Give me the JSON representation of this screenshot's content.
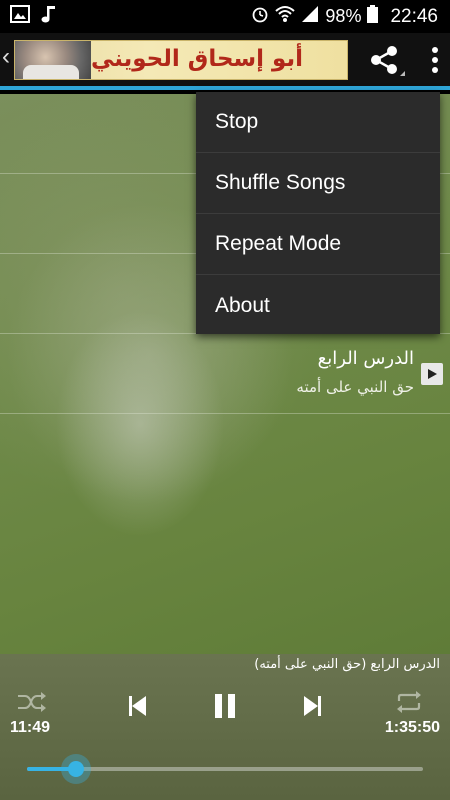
{
  "status_bar": {
    "battery_percent": "98%",
    "time": "22:46",
    "icons": [
      "image-icon",
      "music-note-icon",
      "alarm-icon",
      "wifi-icon",
      "signal-icon",
      "battery-icon"
    ]
  },
  "action_bar": {
    "banner_text": "أبو إسحاق الحويني",
    "icons": [
      "back-chevron-icon",
      "share-icon",
      "overflow-menu-icon"
    ]
  },
  "menu": {
    "items": [
      {
        "label": "Stop"
      },
      {
        "label": "Shuffle Songs"
      },
      {
        "label": "Repeat Mode"
      },
      {
        "label": "About"
      }
    ]
  },
  "track_list": {
    "current": {
      "title": "الدرس الرابع",
      "subtitle": "حق النبي على أمته"
    }
  },
  "player": {
    "now_playing": "الدرس الرابع (حق النبي على أمته)",
    "elapsed": "11:49",
    "duration": "1:35:50",
    "progress_fraction": 0.123,
    "state": "playing"
  },
  "colors": {
    "accent": "#37b3e4",
    "menu_bg": "#2b2b2b",
    "banner_text": "#b1281a"
  }
}
